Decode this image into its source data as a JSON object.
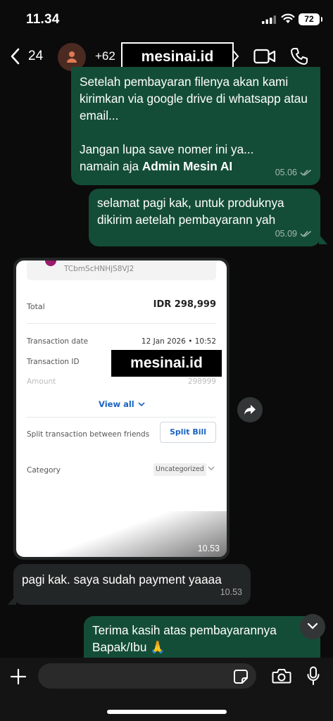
{
  "status_bar": {
    "time": "11.34",
    "battery": "72"
  },
  "header": {
    "back_count": "24",
    "contact_number": "+62",
    "watermark": "mesinai.id"
  },
  "messages": [
    {
      "direction": "outgoing",
      "text": "Setelah pembayaran filenya akan kami kirimkan via google drive di whatsapp atau email...\n\nJangan lupa save nomer ini ya...\nnamain aja ",
      "bold_text": "Admin Mesin AI",
      "time": "05.06",
      "status": "read"
    },
    {
      "direction": "outgoing",
      "text": "selamat pagi kak, untuk produknya dikirim aetelah pembayarann yah",
      "time": "05.09",
      "status": "read"
    },
    {
      "direction": "incoming",
      "type": "image",
      "time": "10.53"
    },
    {
      "direction": "incoming",
      "text": "pagi kak. saya sudah payment yaaaa",
      "time": "10.53"
    },
    {
      "direction": "outgoing",
      "text": "Terima kasih atas pembayarannya Bapak/Ibu 🙏"
    }
  ],
  "receipt": {
    "tx_ref": "TCbmScHNHjS8VJ2",
    "total_label": "Total",
    "total_value": "IDR 298,999",
    "date_label": "Transaction date",
    "date_value": "12 Jan 2026 • 10:52",
    "id_label": "Transaction ID",
    "watermark": "mesinai.id",
    "amount_label": "Amount",
    "amount_value": "298999",
    "view_all": "View all",
    "split_label": "Split transaction between friends",
    "split_button": "Split Bill",
    "category_label": "Category",
    "category_value": "Uncategorized"
  },
  "composer": {
    "placeholder": ""
  },
  "colors": {
    "outgoing_bubble": "#144d37",
    "incoming_bubble": "#232626",
    "background": "#0b0b0b",
    "link_blue": "#1a63c0"
  }
}
